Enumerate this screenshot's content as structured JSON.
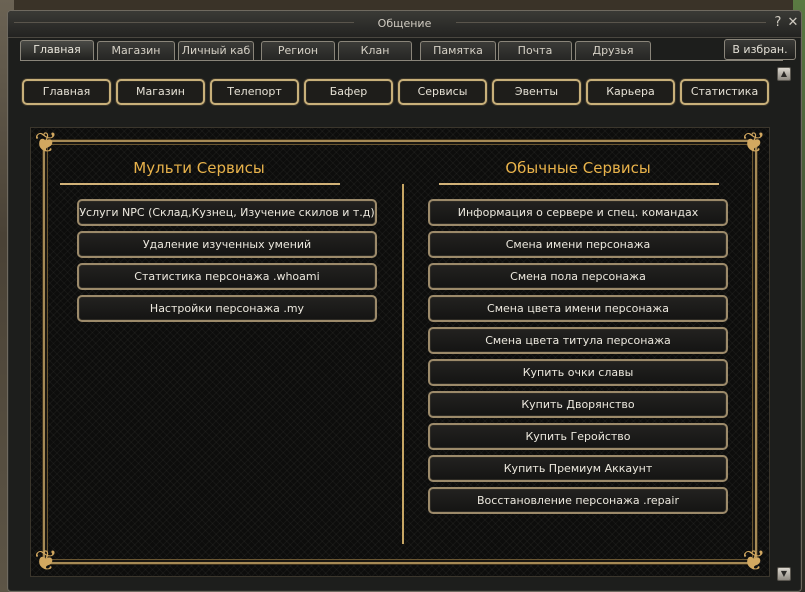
{
  "window": {
    "title": "Общение"
  },
  "controls": {
    "help_glyph": "?",
    "close_glyph": "✕"
  },
  "tabs": [
    {
      "label": "Главная",
      "active": true
    },
    {
      "label": "Магазин",
      "active": false
    },
    {
      "label": "Личный каб",
      "active": false
    },
    {
      "label": "Регион",
      "active": false
    },
    {
      "label": "Клан",
      "active": false
    },
    {
      "label": "Памятка",
      "active": false
    },
    {
      "label": "Почта",
      "active": false
    },
    {
      "label": "Друзья",
      "active": false
    }
  ],
  "favorites_button": "В избран.",
  "nav": [
    "Главная",
    "Магазин",
    "Телепорт",
    "Бафер",
    "Сервисы",
    "Эвенты",
    "Карьера",
    "Статистика"
  ],
  "multi_services": {
    "title": "Мульти Сервисы",
    "items": [
      "Услуги NPC (Склад,Кузнец, Изучение скилов и т.д)",
      "Удаление изученных умений",
      "Статистика персонажа .whoami",
      "Настройки персонажа .my"
    ]
  },
  "regular_services": {
    "title": "Обычные Сервисы",
    "items": [
      "Информация о сервере и спец. командах",
      "Смена имени персонажа",
      "Смена пола персонажа",
      "Смена цвета имени персонажа",
      "Смена цвета титула персонажа",
      "Купить очки славы",
      "Купить Дворянство",
      "Купить Геройство",
      "Купить Премиум Аккаунт",
      "Восстановление персонажа .repair"
    ]
  },
  "colors": {
    "accent_gold": "#e8b24a",
    "frame_gold": "#a68a55",
    "nav_border": "#c8b07a",
    "button_border": "#9c8a6a"
  }
}
